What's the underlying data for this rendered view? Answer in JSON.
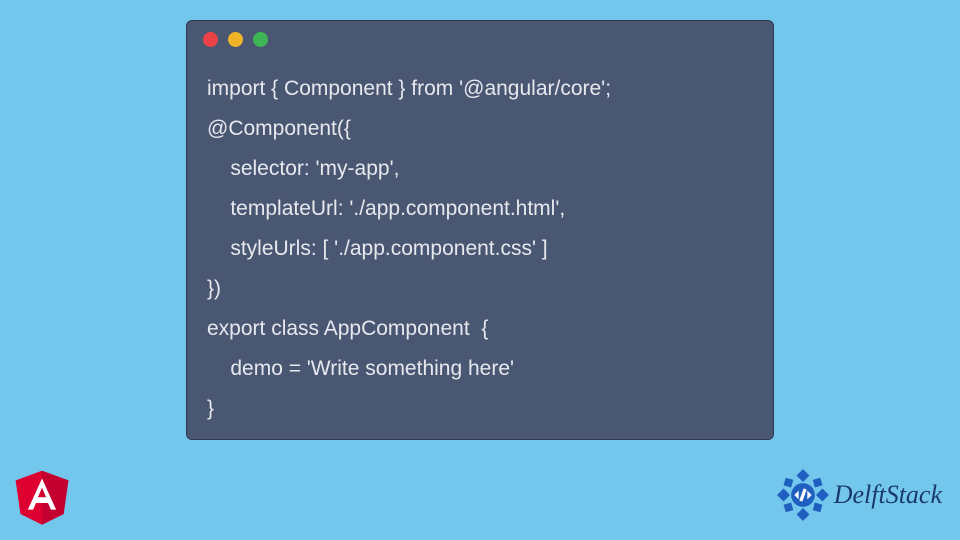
{
  "code": {
    "lines": [
      "import { Component } from '@angular/core';",
      "@Component({",
      "    selector: 'my-app',",
      "    templateUrl: './app.component.html',",
      "    styleUrls: [ './app.component.css' ]",
      "})",
      "export class AppComponent  {",
      "    demo = 'Write something here'",
      "}"
    ]
  },
  "window": {
    "dots": {
      "red": "#ed4245",
      "yellow": "#f0b429",
      "green": "#3eb655"
    },
    "bg": "#4a5772"
  },
  "logos": {
    "angular_letter": "A",
    "delft_text": "DelftStack"
  },
  "colors": {
    "page_bg": "#74c7ec",
    "code_fg": "#e6e8ee",
    "angular_red": "#dd0031",
    "angular_dark": "#b3002a",
    "delft_blue": "#1f5fbf"
  }
}
